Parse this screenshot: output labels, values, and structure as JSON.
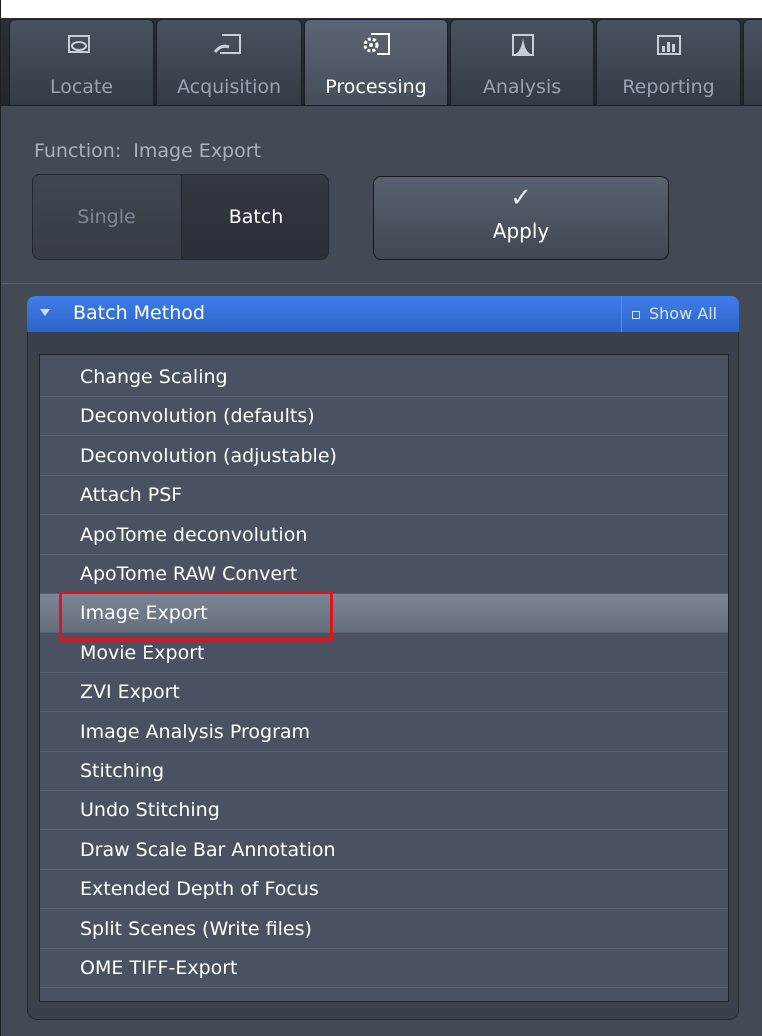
{
  "tabs": [
    {
      "label": "Locate",
      "icon": "locate-icon"
    },
    {
      "label": "Acquisition",
      "icon": "acquisition-icon"
    },
    {
      "label": "Processing",
      "icon": "processing-icon",
      "active": true
    },
    {
      "label": "Analysis",
      "icon": "analysis-icon"
    },
    {
      "label": "Reporting",
      "icon": "reporting-icon"
    }
  ],
  "function": {
    "label": "Function:",
    "value": "Image Export"
  },
  "mode": {
    "single": "Single",
    "batch": "Batch",
    "selected": "Batch"
  },
  "apply_button": {
    "label": "Apply",
    "icon": "checkmark-icon"
  },
  "batch_method": {
    "title": "Batch Method",
    "show_all": "Show All",
    "items": [
      "Change Scaling",
      "Deconvolution (defaults)",
      "Deconvolution (adjustable)",
      "Attach PSF",
      "ApoTome deconvolution",
      "ApoTome RAW Convert",
      "Image Export",
      "Movie Export",
      "ZVI Export",
      "Image Analysis Program",
      "Stitching",
      "Undo Stitching",
      "Draw Scale Bar Annotation",
      "Extended Depth of Focus",
      "Split Scenes (Write files)",
      "OME TIFF-Export"
    ],
    "selected_item": "Image Export"
  },
  "colors": {
    "panel": "#434a56",
    "header_blue": "#3a76e0",
    "highlight_red": "#e0141e"
  }
}
